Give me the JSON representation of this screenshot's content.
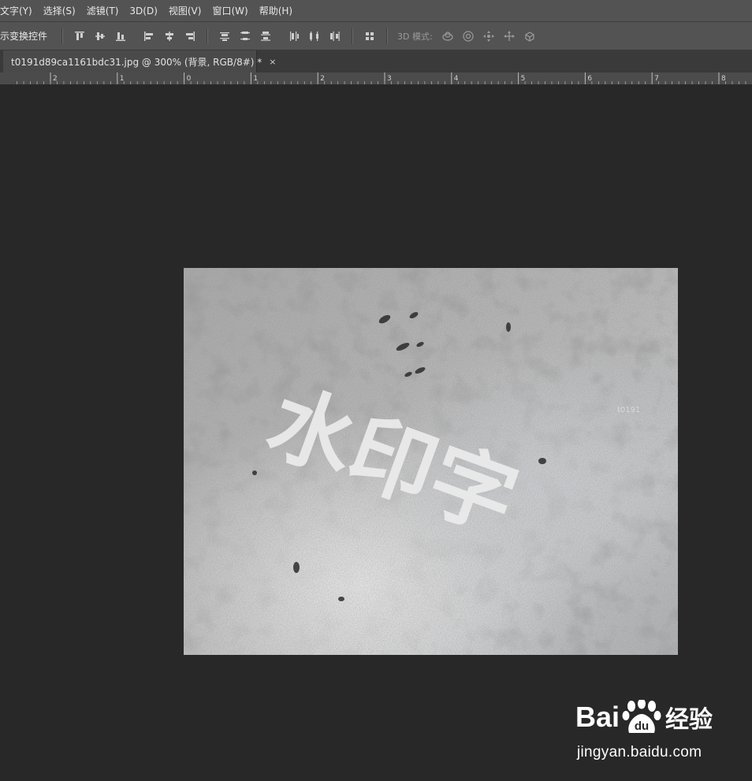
{
  "menu": [
    {
      "label": "文字(Y)"
    },
    {
      "label": "选择(S)"
    },
    {
      "label": "滤镜(T)"
    },
    {
      "label": "3D(D)"
    },
    {
      "label": "视图(V)"
    },
    {
      "label": "窗口(W)"
    },
    {
      "label": "帮助(H)"
    }
  ],
  "options_bar": {
    "transform_label": "示变换控件",
    "mode_3d_label": "3D 模式:",
    "align_icons": [
      "align-top-edges-icon",
      "align-vertical-centers-icon",
      "align-bottom-edges-icon",
      "align-left-edges-icon",
      "align-horizontal-centers-icon",
      "align-right-edges-icon"
    ],
    "distribute_icons": [
      "distribute-top-icon",
      "distribute-vertical-centers-icon",
      "distribute-bottom-icon",
      "distribute-left-icon",
      "distribute-horizontal-centers-icon",
      "distribute-right-icon"
    ],
    "auto_align_icon": "auto-align-layers-icon",
    "mode_3d_icons": [
      "rotate-3d-icon",
      "roll-3d-icon",
      "drag-3d-icon",
      "slide-3d-icon",
      "scale-3d-icon"
    ]
  },
  "document_tab": {
    "title": "t0191d89ca1161bdc31.jpg @ 300% (背景, RGB/8#) *",
    "close_glyph": "×"
  },
  "ruler": {
    "labels": [
      "2",
      "1",
      "0",
      "1",
      "2",
      "3",
      "4",
      "5",
      "6",
      "7",
      "8"
    ]
  },
  "canvas": {
    "image_text": "水印字",
    "image_corner_text": "t0191"
  },
  "watermark": {
    "logo_text_1": "Bai",
    "logo_text_2": "经验",
    "paw_text": "du",
    "url": "jingyan.baidu.com"
  },
  "colors": {
    "menubar_bg": "#535353",
    "canvas_bg": "#282828",
    "tab_bg": "#4a4a4a"
  }
}
